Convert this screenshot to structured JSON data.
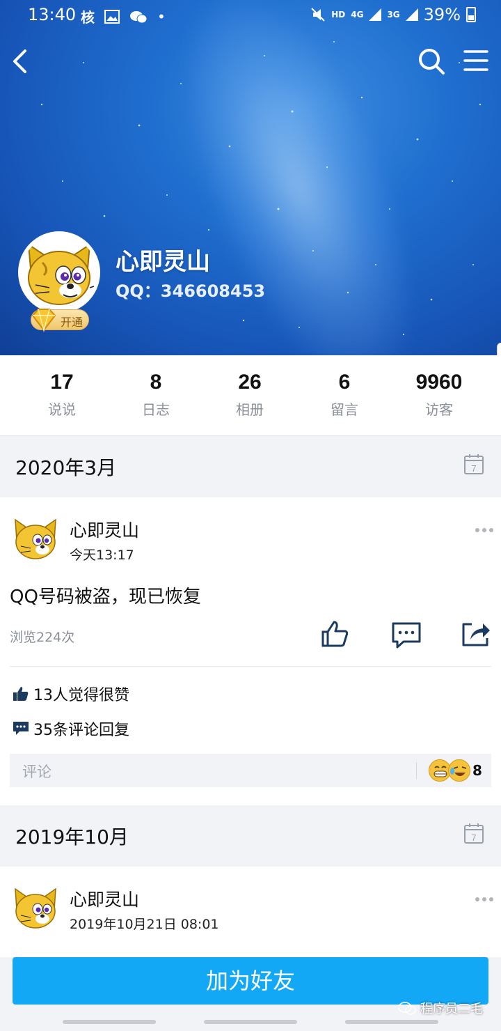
{
  "status_bar": {
    "time": "13:40",
    "left_icons": [
      "tencent-icon",
      "gallery-icon",
      "wechat-icon",
      "dot"
    ],
    "hd": "HD",
    "net1": "4G",
    "net2": "3G",
    "battery": "39%"
  },
  "profile": {
    "name": "心即灵山",
    "qq": "QQ：346608453",
    "vip_label": "开通"
  },
  "stats": [
    {
      "num": "17",
      "label": "说说"
    },
    {
      "num": "8",
      "label": "日志"
    },
    {
      "num": "26",
      "label": "相册"
    },
    {
      "num": "6",
      "label": "留言"
    },
    {
      "num": "9960",
      "label": "访客"
    }
  ],
  "sections": [
    {
      "month": "2020年3月"
    },
    {
      "month": "2019年10月"
    }
  ],
  "calendar_day": "7",
  "post1": {
    "author": "心即灵山",
    "time": "今天13:17",
    "text": "QQ号码被盗，现已恢复",
    "views": "浏览224次",
    "likes": "13人觉得很赞",
    "comments": "35条评论回复",
    "comment_placeholder": "评论",
    "emoji_count": "8"
  },
  "post2": {
    "author": "心即灵山",
    "time": "2019年10月21日 08:01"
  },
  "add_friend": "加为好友",
  "watermark": "程序员二毛",
  "colors": {
    "primary": "#12a8f5",
    "header_blue": "#1f6fd0",
    "icon_dark": "#1b3a60"
  }
}
